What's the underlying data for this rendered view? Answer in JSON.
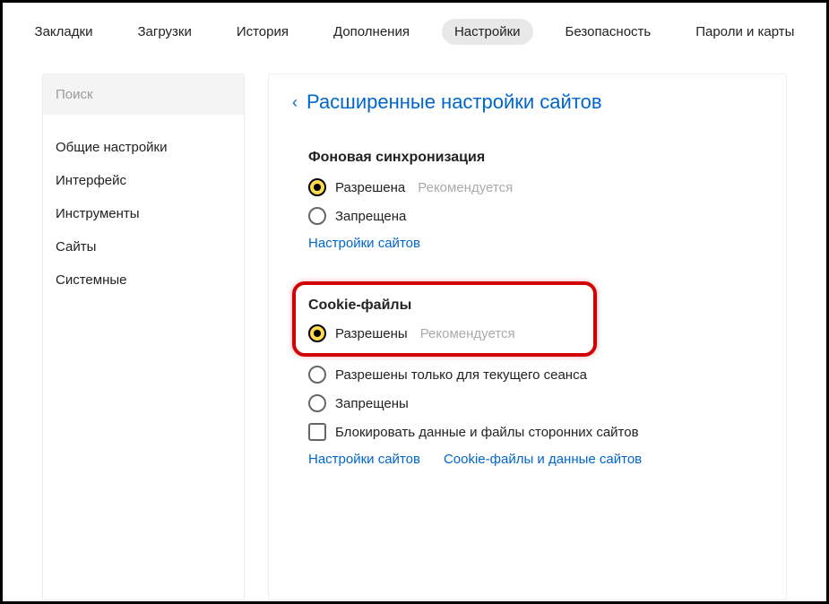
{
  "topnav": {
    "items": [
      {
        "label": "Закладки"
      },
      {
        "label": "Загрузки"
      },
      {
        "label": "История"
      },
      {
        "label": "Дополнения"
      },
      {
        "label": "Настройки"
      },
      {
        "label": "Безопасность"
      },
      {
        "label": "Пароли и карты"
      }
    ]
  },
  "sidebar": {
    "search_placeholder": "Поиск",
    "items": [
      {
        "label": "Общие настройки"
      },
      {
        "label": "Интерфейс"
      },
      {
        "label": "Инструменты"
      },
      {
        "label": "Сайты"
      },
      {
        "label": "Системные"
      }
    ]
  },
  "main": {
    "back_chevron": "‹",
    "title": "Расширенные настройки сайтов",
    "section_sync": {
      "title": "Фоновая синхронизация",
      "opt_allowed": "Разрешена",
      "opt_allowed_hint": "Рекомендуется",
      "opt_denied": "Запрещена",
      "link_sites": "Настройки сайтов"
    },
    "section_cookies": {
      "title": "Cookie-файлы",
      "opt_allowed": "Разрешены",
      "opt_allowed_hint": "Рекомендуется",
      "opt_session": "Разрешены только для текущего сеанса",
      "opt_denied": "Запрещены",
      "opt_block_third": "Блокировать данные и файлы сторонних сайтов",
      "link_sites": "Настройки сайтов",
      "link_data": "Cookie-файлы и данные сайтов"
    }
  }
}
